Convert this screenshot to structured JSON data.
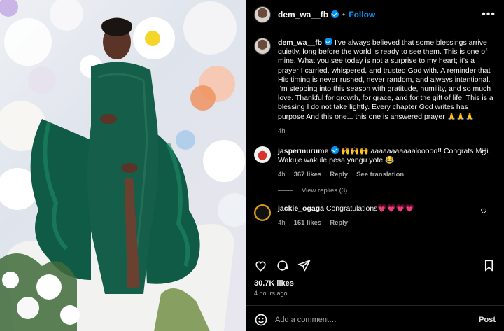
{
  "post": {
    "author": "dem_wa__fb",
    "follow_label": "Follow",
    "separator": "•",
    "more_label": "•••",
    "caption_text": "I've always believed that some blessings arrive quietly, long before the world is ready to see them. This is one of mine. What you see today is not a surprise to my heart; it's a prayer I carried, whispered, and trusted God with. A reminder that His timing is never rushed, never random, and always intentional. I'm stepping into this season with gratitude, humility, and so much love. Thankful for growth, for grace, and for the gift of life. This is a blessing I do not take lightly. Every chapter God writes has purpose And this one... this one is answered prayer 🙏🙏🙏",
    "caption_time": "4h"
  },
  "comments": [
    {
      "username": "jaspermurume",
      "text": "🙌🙌🙌 aaaaaaaaaaalooooo!! Congrats Milli. Wakuje wakule pesa yangu yote 😂",
      "time": "4h",
      "likes": "367 likes",
      "reply": "Reply",
      "translate": "See translation",
      "view_replies": "View replies (3)"
    },
    {
      "username": "jackie_ogaga",
      "text": "Congratulations💗💗💗💗",
      "time": "4h",
      "likes": "161 likes",
      "reply": "Reply"
    }
  ],
  "footer": {
    "likes": "30.7K likes",
    "time_ago": "4 hours ago",
    "comment_placeholder": "Add a comment…",
    "post_label": "Post"
  },
  "icons": [
    "heart-icon",
    "comment-icon",
    "share-icon",
    "bookmark-icon",
    "emoji-icon",
    "verified-icon"
  ],
  "colors": {
    "accent": "#0095f6",
    "background": "#000000",
    "secondary_text": "#a8a8a8",
    "dress": "#0f5b45"
  }
}
